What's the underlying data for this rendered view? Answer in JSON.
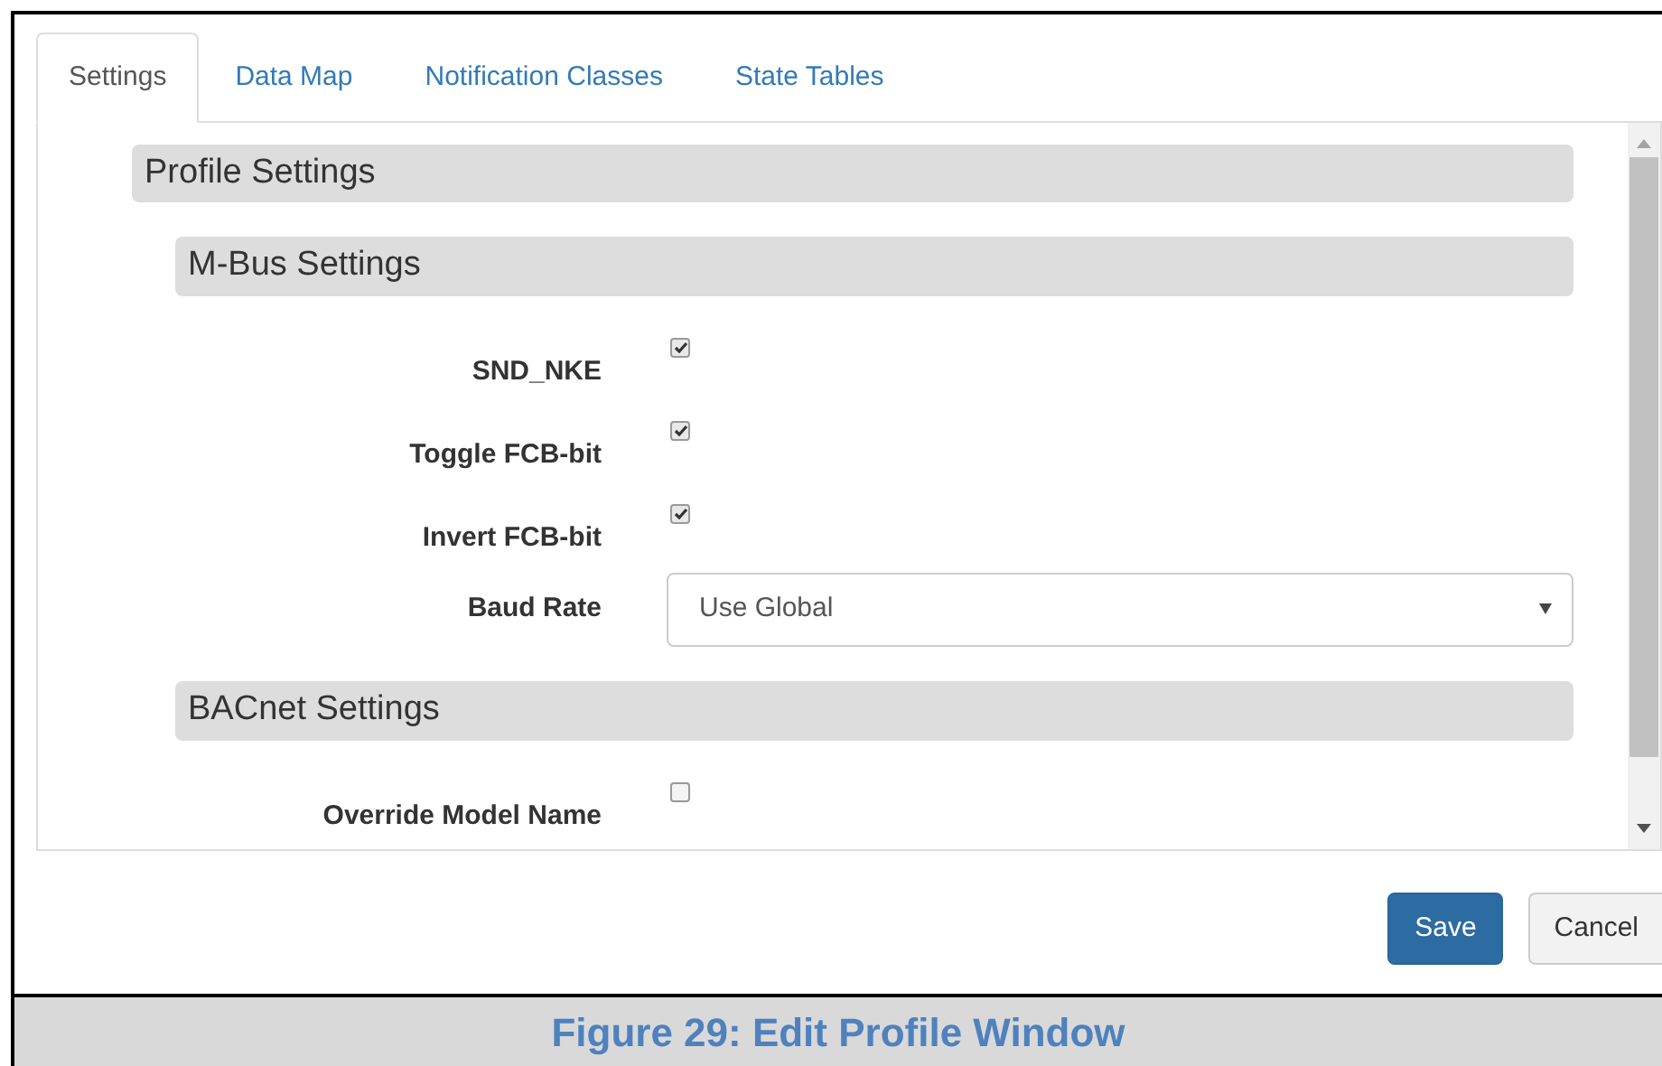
{
  "tabs": [
    {
      "label": "Settings",
      "selected": true
    },
    {
      "label": "Data Map",
      "selected": false
    },
    {
      "label": "Notification Classes",
      "selected": false
    },
    {
      "label": "State Tables",
      "selected": false
    }
  ],
  "section": {
    "title": "Profile Settings",
    "children": [
      {
        "title": "M-Bus Settings",
        "fields": [
          {
            "kind": "checkbox",
            "label": "SND_NKE",
            "checked": true
          },
          {
            "kind": "checkbox",
            "label": "Toggle FCB-bit",
            "checked": true
          },
          {
            "kind": "checkbox",
            "label": "Invert FCB-bit",
            "checked": true
          },
          {
            "kind": "select",
            "label": "Baud Rate",
            "value": "Use Global"
          }
        ]
      },
      {
        "title": "BACnet Settings",
        "fields": [
          {
            "kind": "checkbox",
            "label": "Override Model Name",
            "checked": false
          }
        ]
      }
    ]
  },
  "buttons": [
    {
      "kind": "primary",
      "label": "Save"
    },
    {
      "kind": "default",
      "label": "Cancel"
    }
  ],
  "caption": "Figure 29: Edit Profile Window"
}
